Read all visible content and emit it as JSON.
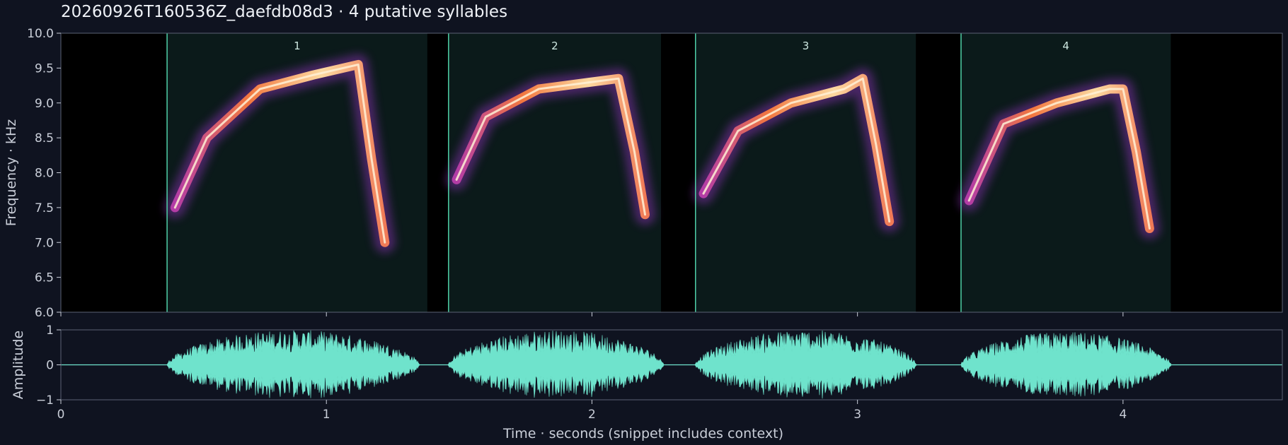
{
  "title": "20260926T160536Z_daefdb08d3  ·  4 putative syllables",
  "colors": {
    "background": "#0f1320",
    "spectrogram_bg": "#000000",
    "syllable_region": "#0b1a1a",
    "syllable_boundary": "#4fd1a8",
    "waveform": "#6fe3cc",
    "axis": "#5b6274"
  },
  "chart_data": [
    {
      "type": "heatmap",
      "title": "20260926T160536Z_daefdb08d3  ·  4 putative syllables",
      "ylabel": "Frequency · kHz",
      "xlim": [
        0,
        4.6
      ],
      "ylim": [
        6.0,
        10.0
      ],
      "yticks": [
        "6.0",
        "6.5",
        "7.0",
        "7.5",
        "8.0",
        "8.5",
        "9.0",
        "9.5",
        "10.0"
      ],
      "colormap": "magma",
      "syllables": [
        {
          "label": "1",
          "start": 0.4,
          "end": 1.38
        },
        {
          "label": "2",
          "start": 1.46,
          "end": 2.26
        },
        {
          "label": "3",
          "start": 2.39,
          "end": 3.22
        },
        {
          "label": "4",
          "start": 3.39,
          "end": 4.18
        }
      ],
      "contours": [
        {
          "syllable": "1",
          "points": [
            [
              0.43,
              7.5
            ],
            [
              0.55,
              8.5
            ],
            [
              0.75,
              9.2
            ],
            [
              0.95,
              9.4
            ],
            [
              1.12,
              9.55
            ],
            [
              1.17,
              8.2
            ],
            [
              1.22,
              7.0
            ]
          ]
        },
        {
          "syllable": "2",
          "points": [
            [
              1.49,
              7.9
            ],
            [
              1.6,
              8.8
            ],
            [
              1.8,
              9.2
            ],
            [
              2.0,
              9.3
            ],
            [
              2.1,
              9.35
            ],
            [
              2.16,
              8.3
            ],
            [
              2.2,
              7.4
            ]
          ]
        },
        {
          "syllable": "3",
          "points": [
            [
              2.42,
              7.7
            ],
            [
              2.55,
              8.6
            ],
            [
              2.75,
              9.0
            ],
            [
              2.95,
              9.2
            ],
            [
              3.02,
              9.35
            ],
            [
              3.07,
              8.4
            ],
            [
              3.12,
              7.3
            ]
          ]
        },
        {
          "syllable": "4",
          "points": [
            [
              3.42,
              7.6
            ],
            [
              3.55,
              8.7
            ],
            [
              3.75,
              9.0
            ],
            [
              3.95,
              9.2
            ],
            [
              4.0,
              9.2
            ],
            [
              4.05,
              8.3
            ],
            [
              4.1,
              7.2
            ]
          ]
        }
      ]
    },
    {
      "type": "area",
      "xlabel": "Time · seconds (snippet includes context)",
      "ylabel": "Amplitude",
      "xlim": [
        0,
        4.6
      ],
      "ylim": [
        -1,
        1
      ],
      "xticks": [
        "0",
        "1",
        "2",
        "3",
        "4"
      ],
      "yticks": [
        "−1",
        "0",
        "1"
      ],
      "bursts": [
        {
          "start": 0.4,
          "end": 1.35,
          "peak": 1.0
        },
        {
          "start": 1.46,
          "end": 2.27,
          "peak": 1.0
        },
        {
          "start": 2.39,
          "end": 3.22,
          "peak": 1.0
        },
        {
          "start": 3.39,
          "end": 4.18,
          "peak": 0.95
        }
      ]
    }
  ]
}
